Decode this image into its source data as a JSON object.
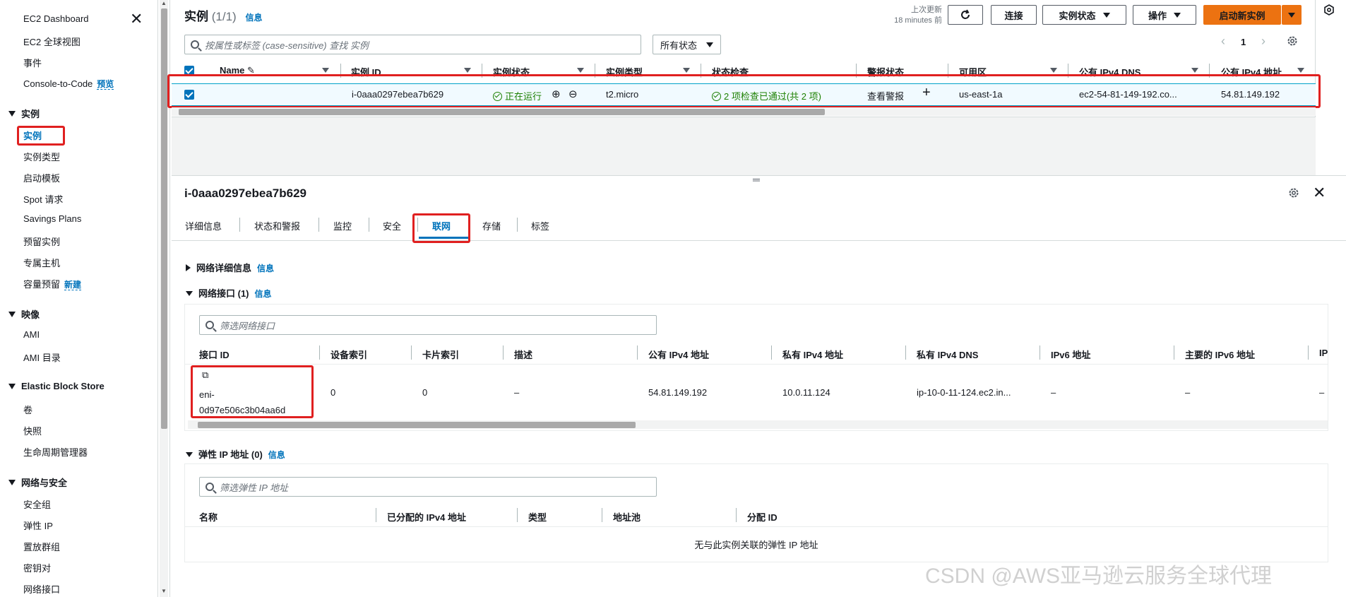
{
  "sidebar": {
    "top_items": [
      "EC2 Dashboard",
      "EC2 全球视图",
      "事件",
      "Console-to-Code"
    ],
    "console_badge": "预览",
    "sections": [
      {
        "title": "实例",
        "items": [
          "实例",
          "实例类型",
          "启动模板",
          "Spot 请求",
          "Savings Plans",
          "预留实例",
          "专属主机",
          "容量预留"
        ]
      },
      {
        "title": "映像",
        "items": [
          "AMI",
          "AMI 目录"
        ]
      },
      {
        "title": "Elastic Block Store",
        "items": [
          "卷",
          "快照",
          "生命周期管理器"
        ]
      },
      {
        "title": "网络与安全",
        "items": [
          "安全组",
          "弹性 IP",
          "置放群组",
          "密钥对",
          "网络接口"
        ]
      }
    ],
    "capacity_badge": "新建"
  },
  "header": {
    "title": "实例",
    "count": "(1/1)",
    "info": "信息",
    "last_updated_label": "上次更新",
    "last_updated_value": "18 minutes 前",
    "connect": "连接",
    "instance_state": "实例状态",
    "actions": "操作",
    "launch": "启动新实例"
  },
  "filter": {
    "placeholder": "按属性或标签 (case-sensitive) 查找 实例",
    "state_select": "所有状态",
    "page": "1"
  },
  "instances_table": {
    "columns": [
      "Name",
      "实例 ID",
      "实例状态",
      "实例类型",
      "状态检查",
      "警报状态",
      "可用区",
      "公有 IPv4 DNS",
      "公有 IPv4 地址"
    ],
    "row": {
      "name": "",
      "instance_id": "i-0aaa0297ebea7b629",
      "state": "正在运行",
      "type": "t2.micro",
      "status_check": "2 项检查已通过(共 2 项)",
      "alarm": "查看警报",
      "az": "us-east-1a",
      "dns": "ec2-54-81-149-192.co...",
      "ipv4": "54.81.149.192"
    }
  },
  "detail": {
    "instance_id": "i-0aaa0297ebea7b629",
    "tabs": [
      "详细信息",
      "状态和警报",
      "监控",
      "安全",
      "联网",
      "存储",
      "标签"
    ],
    "active_tab": "联网",
    "network_details": "网络详细信息",
    "network_interfaces": "网络接口 (1)",
    "info": "信息",
    "eni_filter_placeholder": "筛选网络接口",
    "eni_columns": [
      "接口 ID",
      "设备索引",
      "卡片索引",
      "描述",
      "公有 IPv4 地址",
      "私有 IPv4 地址",
      "私有 IPv4 DNS",
      "IPv6 地址",
      "主要的 IPv6 地址",
      "IP"
    ],
    "eni_row": {
      "id_line1": "eni-",
      "id_line2": "0d97e506c3b04aa6d",
      "device_index": "0",
      "card_index": "0",
      "description": "–",
      "public_ipv4": "54.81.149.192",
      "private_ipv4": "10.0.11.124",
      "private_dns": "ip-10-0-11-124.ec2.in...",
      "ipv6": "–",
      "primary_ipv6": "–",
      "last": "–"
    },
    "eip_title": "弹性 IP 地址 (0)",
    "eip_filter_placeholder": "筛选弹性 IP 地址",
    "eip_columns": [
      "名称",
      "已分配的 IPv4 地址",
      "类型",
      "地址池",
      "分配 ID"
    ],
    "eip_empty": "无与此实例关联的弹性 IP 地址"
  },
  "watermark": "CSDN @AWS亚马逊云服务全球代理",
  "colors": {
    "accent": "#0073bb",
    "primary": "#ec7211",
    "success": "#1d8102",
    "highlight": "#e02020"
  }
}
